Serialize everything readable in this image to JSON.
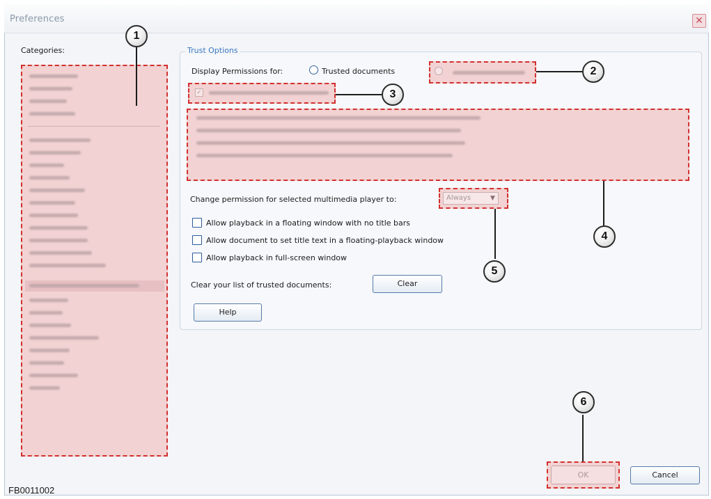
{
  "window": {
    "title": "Preferences",
    "close_glyph": "✕"
  },
  "categories": {
    "label": "Categories:"
  },
  "trust_options": {
    "legend": "Trust Options",
    "display_label": "Display Permissions for:",
    "radio_trusted_label": "Trusted documents",
    "change_label": "Change permission for selected multimedia player to:",
    "permission_value": "Always",
    "options": [
      {
        "label": "Allow playback in a floating window with no title bars",
        "checked": false
      },
      {
        "label": "Allow document to set title text in a floating-playback window",
        "checked": false
      },
      {
        "label": "Allow playback in full-screen window",
        "checked": false
      }
    ],
    "clear_label": "Clear your list of trusted documents:",
    "clear_button": "Clear",
    "help_button": "Help"
  },
  "buttons": {
    "ok": "OK",
    "cancel": "Cancel"
  },
  "callouts": [
    "1",
    "2",
    "3",
    "4",
    "5",
    "6"
  ],
  "figure_code": "FB0011002",
  "colors": {
    "highlight_fill": "#f2d2d2",
    "highlight_border": "#d32f2f",
    "legend_blue": "#3a78c2"
  }
}
